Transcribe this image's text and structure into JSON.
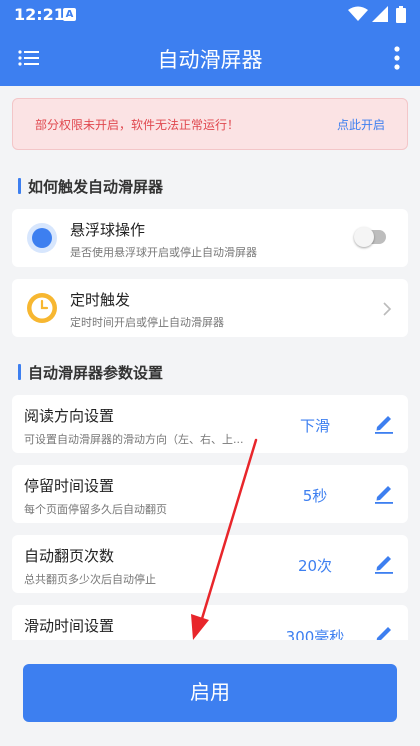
{
  "status_bar": {
    "time": "12:21",
    "notification_glyph": "A",
    "icons": [
      "wifi-icon",
      "signal-icon",
      "battery-icon"
    ]
  },
  "app_bar": {
    "title": "自动滑屏器",
    "menu_icon": "menu-icon",
    "more_icon": "more-vert-icon"
  },
  "warning": {
    "message": "部分权限未开启，软件无法正常运行！",
    "link": "点此开启"
  },
  "trigger_section": {
    "title": "如何触发自动滑屏器",
    "items": [
      {
        "title": "悬浮球操作",
        "subtitle": "是否使用悬浮球开启或停止自动滑屏器",
        "control": "toggle",
        "toggle_on": false,
        "icon": "floating-ball-icon"
      },
      {
        "title": "定时触发",
        "subtitle": "定时时间开启或停止自动滑屏器",
        "control": "chevron",
        "icon": "clock-icon"
      }
    ]
  },
  "params_section": {
    "title": "自动滑屏器参数设置",
    "items": [
      {
        "title": "阅读方向设置",
        "subtitle": "可设置自动滑屏器的滑动方向（左、右、上...",
        "value": "下滑"
      },
      {
        "title": "停留时间设置",
        "subtitle": "每个页面停留多久后自动翻页",
        "value": "5秒"
      },
      {
        "title": "自动翻页次数",
        "subtitle": "总共翻页多少次后自动停止",
        "value": "20次"
      },
      {
        "title": "滑动时间设置",
        "subtitle": "",
        "value": "300毫秒"
      }
    ]
  },
  "enable_button": {
    "label": "启用"
  },
  "colors": {
    "primary": "#3d7ff0",
    "warning_bg": "#fbe3e4",
    "warning_text": "#e0484f",
    "page_bg": "#f3f4f6",
    "clock_yellow": "#f7b731",
    "annotation_arrow": "#e8262b"
  }
}
